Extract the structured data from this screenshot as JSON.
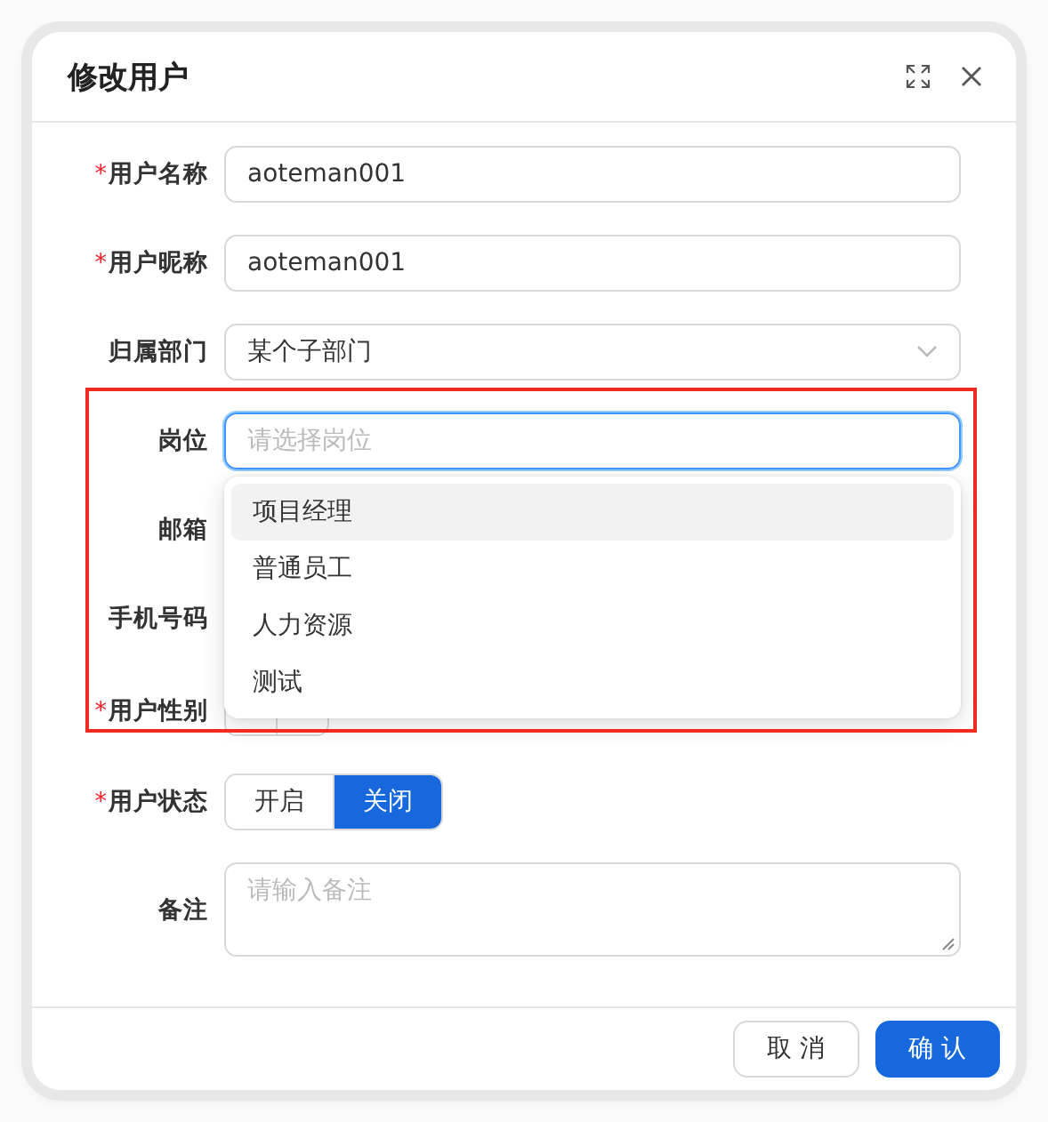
{
  "dialog": {
    "title": "修改用户"
  },
  "fields": [
    {
      "label": "用户名称",
      "required_mark": "*",
      "kind": "input",
      "value": "aoteman001"
    },
    {
      "label": "用户昵称",
      "required_mark": "*",
      "kind": "input",
      "value": "aoteman001"
    },
    {
      "label": "归属部门",
      "kind": "select",
      "value": "某个子部门"
    },
    {
      "label": "岗位",
      "kind": "select-open",
      "placeholder": "请选择岗位",
      "focused": true,
      "options": [
        {
          "label": "项目经理",
          "active": true
        },
        {
          "label": "普通员工",
          "active": false
        },
        {
          "label": "人力资源",
          "active": false
        },
        {
          "label": "测试",
          "active": false
        }
      ]
    },
    {
      "label": "邮箱"
    },
    {
      "label": "手机号码"
    },
    {
      "label": "用户性别",
      "required_mark": "*",
      "kind": "segmented"
    },
    {
      "label": "用户状态",
      "required_mark": "*",
      "kind": "segmented",
      "options": [
        {
          "label": "开启",
          "selected": false
        },
        {
          "label": "关闭",
          "selected": true
        }
      ]
    },
    {
      "label": "备注",
      "kind": "textarea",
      "placeholder": "请输入备注"
    }
  ],
  "buttons": [
    {
      "label": "取 消",
      "primary": false
    },
    {
      "label": "确 认",
      "primary": true
    }
  ]
}
